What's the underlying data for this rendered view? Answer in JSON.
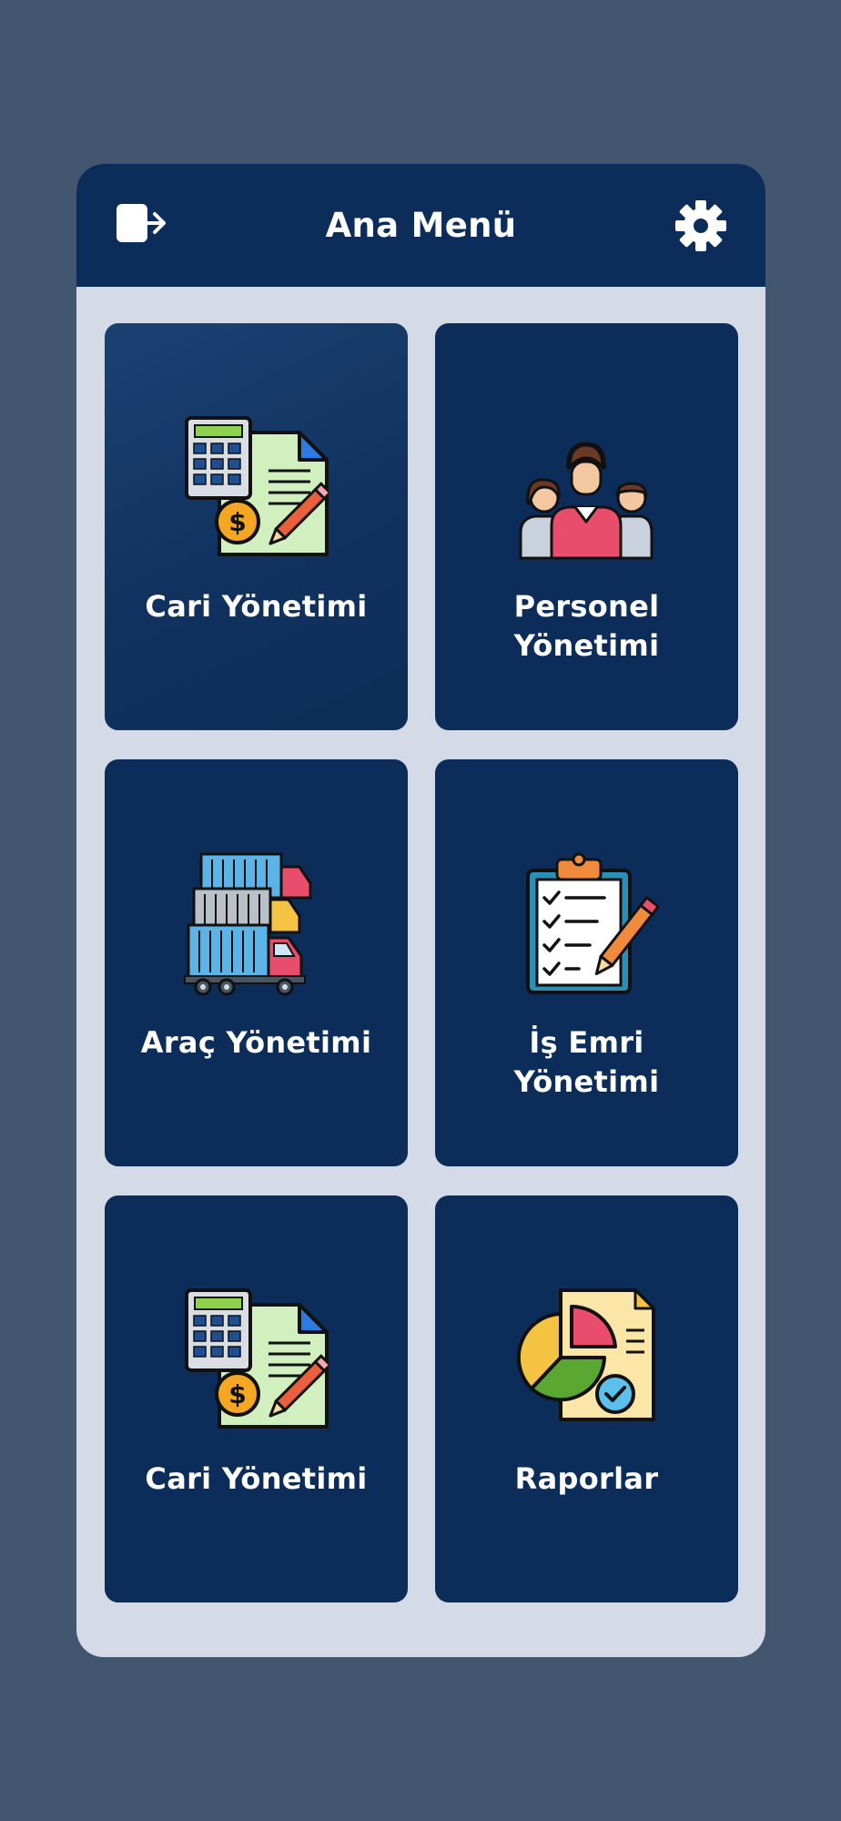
{
  "header": {
    "title": "Ana Menü",
    "logout_icon": "logout-icon",
    "settings_icon": "gear-icon"
  },
  "menu": {
    "tiles": [
      {
        "lines": [
          "Cari Yönetimi"
        ],
        "icon": "accounting-calculator-icon",
        "highlighted": true
      },
      {
        "lines": [
          "Personel",
          "Yönetimi"
        ],
        "icon": "team-people-icon"
      },
      {
        "lines": [
          "Araç Yönetimi"
        ],
        "icon": "truck-fleet-icon"
      },
      {
        "lines": [
          "İş Emri",
          "Yönetimi"
        ],
        "icon": "clipboard-checklist-icon"
      },
      {
        "lines": [
          "Cari Yönetimi"
        ],
        "icon": "accounting-calculator-icon"
      },
      {
        "lines": [
          "Raporlar"
        ],
        "icon": "pie-chart-report-icon"
      }
    ]
  },
  "colors": {
    "background": "#42566f",
    "card": "#d4dbe6",
    "navy": "#0c2d5a",
    "text": "#ffffff"
  }
}
